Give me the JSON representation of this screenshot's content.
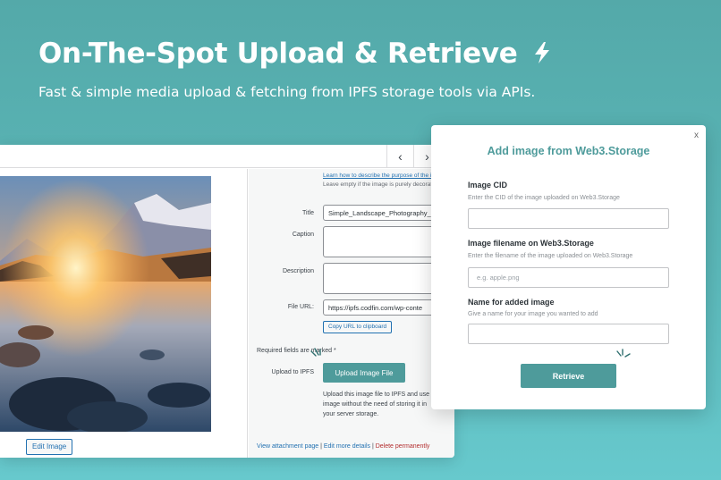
{
  "hero": {
    "title": "On-The-Spot Upload & Retrieve",
    "subtitle": "Fast & simple media upload & fetching from IPFS storage tools via APIs."
  },
  "wp": {
    "nav": {
      "prev": "‹",
      "next": "›"
    },
    "help_link": "Learn how to describe the purpose of the image",
    "help_rest": ". Leave empty if the image is purely decorative.",
    "fields": {
      "title_label": "Title",
      "title_value": "Simple_Landscape_Photography_",
      "caption_label": "Caption",
      "description_label": "Description",
      "file_url_label": "File URL:",
      "file_url_value": "https://ipfs.codfin.com/wp-conte"
    },
    "copy_url": "Copy URL to clipboard",
    "required_text": "Required fields are marked *",
    "upload_label": "Upload to IPFS",
    "upload_button": "Upload Image File",
    "upload_desc": "Upload this image file to IPFS and use image without the need of storing it in your server storage.",
    "edit_image": "Edit Image",
    "footer": {
      "view": "View attachment page",
      "edit": "Edit more details",
      "delete": "Delete permanently",
      "sep": " | "
    }
  },
  "modal": {
    "close": "x",
    "title": "Add image from Web3.Storage",
    "cid_label": "Image CID",
    "cid_help": "Enter the CID of the image uploaded on Web3.Storage",
    "filename_label": "Image filename on Web3.Storage",
    "filename_help": "Enter the filename of the image uploaded on Web3.Storage",
    "filename_placeholder": "e.g. apple.png",
    "name_label": "Name for added image",
    "name_help": "Give a name for your image you wanted to add",
    "retrieve": "Retrieve"
  },
  "colors": {
    "accent": "#4e9b9b",
    "link": "#2271b1",
    "danger": "#b32d2e"
  },
  "icons": {
    "hero": "lightning-icon",
    "sparkle": "sparkle-icon"
  }
}
